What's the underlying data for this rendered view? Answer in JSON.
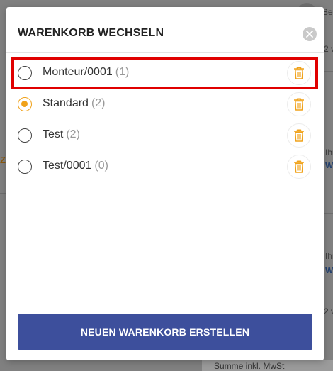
{
  "background": {
    "top_text": "Bez",
    "side_text_1": "2 v",
    "side_text_2": "Ihr",
    "side_text_3": "W",
    "side_text_4": "Ihr",
    "side_text_5": "W",
    "side_text_6": "2 v",
    "left_orange": "Z",
    "bottom_text": "Summe inkl. MwSt"
  },
  "modal": {
    "title": "WARENKORB WECHSELN",
    "close_icon": "close-icon",
    "create_button_label": "NEUEN WARENKORB ERSTELLEN"
  },
  "carts": [
    {
      "name": "Monteur/0001",
      "count": "(1)",
      "selected": false,
      "highlighted": true
    },
    {
      "name": "Standard",
      "count": "(2)",
      "selected": true,
      "highlighted": false
    },
    {
      "name": "Test",
      "count": "(2)",
      "selected": false,
      "highlighted": false
    },
    {
      "name": "Test/0001",
      "count": "(0)",
      "selected": false,
      "highlighted": false
    }
  ],
  "colors": {
    "accent": "#f0a21a",
    "primary_button": "#3d4f9c",
    "highlight": "#e00000"
  },
  "icons": {
    "delete": "trash-icon",
    "close": "close-icon"
  }
}
